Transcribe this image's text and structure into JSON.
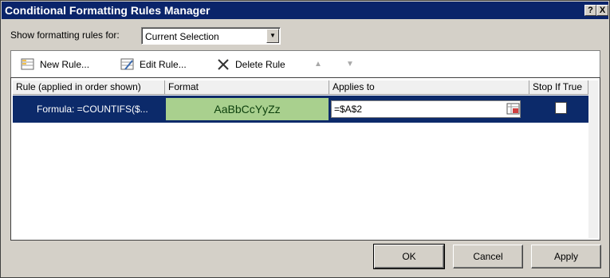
{
  "window": {
    "title": "Conditional Formatting Rules Manager",
    "help_glyph": "?",
    "close_glyph": "X"
  },
  "filter": {
    "label": "Show formatting rules for:",
    "selected": "Current Selection"
  },
  "toolbar": {
    "new_rule": "New Rule...",
    "edit_rule": "Edit Rule...",
    "delete_rule": "Delete Rule",
    "move_up_glyph": "▲",
    "move_down_glyph": "▼"
  },
  "table": {
    "headers": {
      "rule": "Rule (applied in order shown)",
      "format": "Format",
      "applies_to": "Applies to",
      "stop_if_true": "Stop If True"
    },
    "rows": [
      {
        "rule": "Formula: =COUNTIFS($...",
        "format_preview": "AaBbCcYyZz",
        "applies_to": "=$A$2",
        "stop_if_true": false
      }
    ]
  },
  "buttons": {
    "ok": "OK",
    "cancel": "Cancel",
    "apply": "Apply"
  },
  "colors": {
    "titlebar": "#0a246a",
    "selection": "#0c2a6a",
    "format_fill": "#a9d08e",
    "dialog_bg": "#d4d0c8"
  }
}
